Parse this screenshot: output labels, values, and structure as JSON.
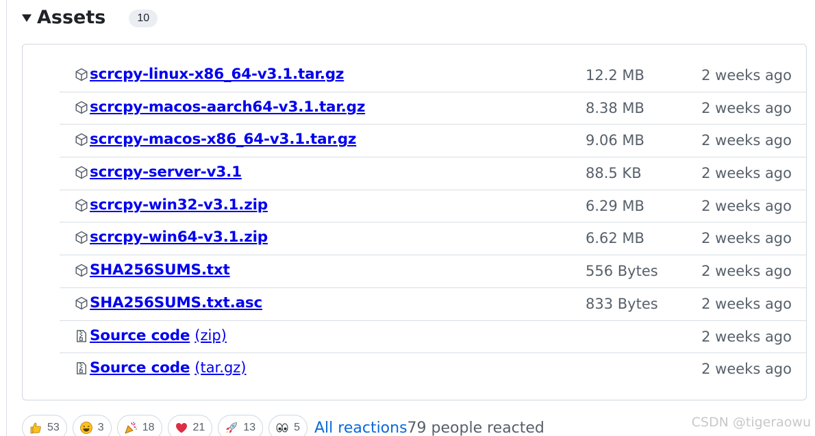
{
  "assets": {
    "title": "Assets",
    "count": "10",
    "items": [
      {
        "name": "scrcpy-linux-x86_64-v3.1.tar.gz",
        "suffix": "",
        "size": "12.2 MB",
        "date": "2 weeks ago",
        "icon": "package-icon"
      },
      {
        "name": "scrcpy-macos-aarch64-v3.1.tar.gz",
        "suffix": "",
        "size": "8.38 MB",
        "date": "2 weeks ago",
        "icon": "package-icon"
      },
      {
        "name": "scrcpy-macos-x86_64-v3.1.tar.gz",
        "suffix": "",
        "size": "9.06 MB",
        "date": "2 weeks ago",
        "icon": "package-icon"
      },
      {
        "name": "scrcpy-server-v3.1",
        "suffix": "",
        "size": "88.5 KB",
        "date": "2 weeks ago",
        "icon": "package-icon"
      },
      {
        "name": "scrcpy-win32-v3.1.zip",
        "suffix": "",
        "size": "6.29 MB",
        "date": "2 weeks ago",
        "icon": "package-icon"
      },
      {
        "name": "scrcpy-win64-v3.1.zip",
        "suffix": "",
        "size": "6.62 MB",
        "date": "2 weeks ago",
        "icon": "package-icon"
      },
      {
        "name": "SHA256SUMS.txt",
        "suffix": "",
        "size": "556 Bytes",
        "date": "2 weeks ago",
        "icon": "package-icon"
      },
      {
        "name": "SHA256SUMS.txt.asc",
        "suffix": "",
        "size": "833 Bytes",
        "date": "2 weeks ago",
        "icon": "package-icon"
      },
      {
        "name": "Source code",
        "suffix": "(zip)",
        "size": "",
        "date": "2 weeks ago",
        "icon": "file-zip-icon"
      },
      {
        "name": "Source code",
        "suffix": "(tar.gz)",
        "size": "",
        "date": "2 weeks ago",
        "icon": "file-zip-icon"
      }
    ]
  },
  "reactions": {
    "items": [
      {
        "emoji": "thumbs-up-icon",
        "count": "53"
      },
      {
        "emoji": "smile-icon",
        "count": "3"
      },
      {
        "emoji": "party-popper-icon",
        "count": "18"
      },
      {
        "emoji": "heart-icon",
        "count": "21"
      },
      {
        "emoji": "rocket-icon",
        "count": "13"
      },
      {
        "emoji": "eyes-icon",
        "count": "5"
      }
    ],
    "all_label": "All reactions",
    "people_text": "79 people reacted"
  },
  "watermark": "CSDN @tigeraowu",
  "colors": {
    "link": "#0000ee",
    "muted": "#57606a",
    "border": "#d0d7de",
    "accent_link": "#0969da"
  }
}
